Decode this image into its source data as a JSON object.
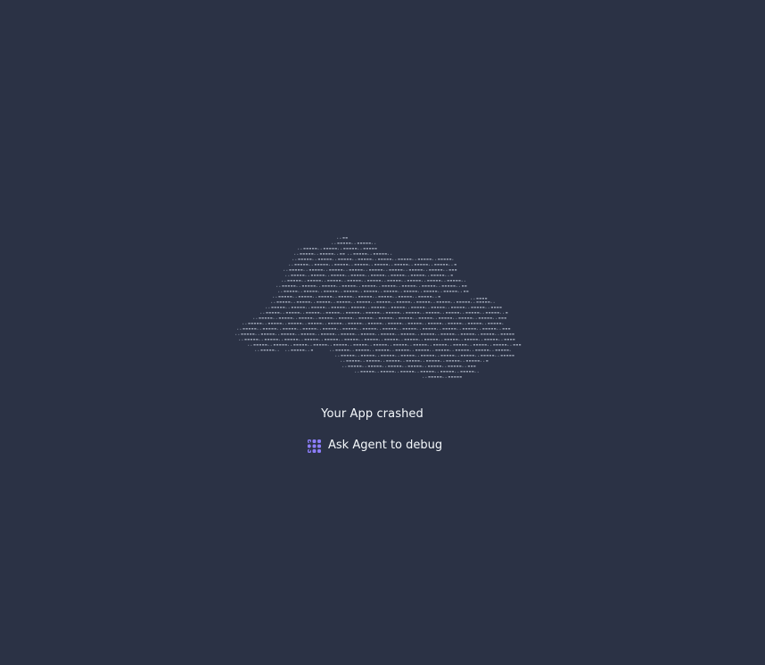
{
  "crash": {
    "title": "Your App crashed",
    "debug_button_label": "Ask Agent to debug"
  },
  "icons": {
    "ascii_cloud": "ascii-cloud-illustration",
    "agent": "agent-icon"
  },
  "colors": {
    "background": "#2b3245",
    "text": "#f5f9fc",
    "ascii": "#a9b1c2",
    "agent_icon": "#8c7dfa"
  }
}
